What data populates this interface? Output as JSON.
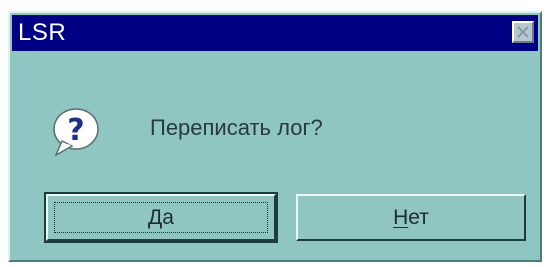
{
  "window": {
    "title": "LSR",
    "message": "Переписать лог?",
    "icon": "question-icon"
  },
  "buttons": {
    "yes": {
      "accel": "Д",
      "rest": "а"
    },
    "no": {
      "accel": "Н",
      "rest": "ет"
    }
  },
  "colors": {
    "titlebar": "#000085",
    "window_bg": "#8fc6c2",
    "text": "#273a3d"
  }
}
